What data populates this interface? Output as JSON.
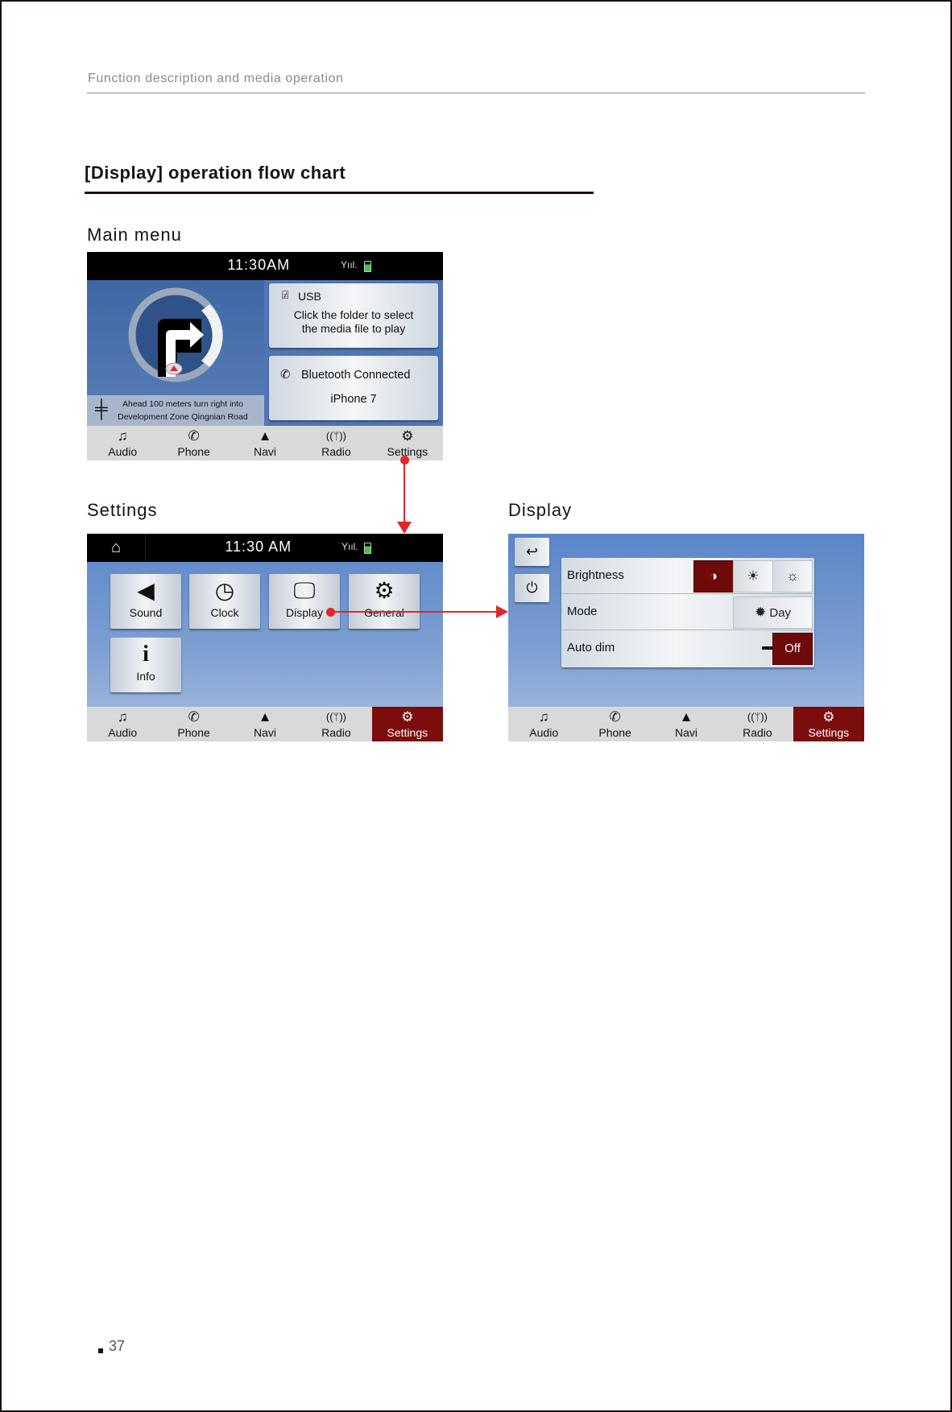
{
  "page": {
    "running_head": "Function description and media operation",
    "section_title": "[Display] operation flow chart",
    "page_number": "37"
  },
  "colors": {
    "accent_red": "#e2262b",
    "active_tab": "#7c0d0d",
    "screen_blue": "#5a86c8"
  },
  "screens": {
    "main_menu": {
      "label": "Main menu",
      "status": {
        "time": "11:30AM",
        "signal_icon": "signal-icon",
        "battery_icon": "battery-icon"
      },
      "nav_guide": {
        "instruction_line1": "Ahead 100 meters turn right into",
        "instruction_line2": "Development Zone Qingnian Road",
        "turn_icon": "turn-right-icon",
        "sign_icon": "signpost-icon"
      },
      "usb_card": {
        "title": "USB",
        "line1": "Click the folder to select",
        "line2": "the media file to play"
      },
      "bt_card": {
        "title": "Bluetooth Connected",
        "device": "iPhone 7"
      }
    },
    "settings": {
      "label": "Settings",
      "status": {
        "time": "11:30 AM"
      },
      "tiles": [
        {
          "label": "Sound",
          "icon": "speaker-icon"
        },
        {
          "label": "Clock",
          "icon": "clock-icon"
        },
        {
          "label": "Display",
          "icon": "monitor-icon"
        },
        {
          "label": "General",
          "icon": "gears-icon"
        },
        {
          "label": "Info",
          "icon": "info-icon"
        }
      ]
    },
    "display": {
      "label": "Display",
      "rows": {
        "brightness": {
          "label": "Brightness",
          "options": [
            "low",
            "medium",
            "high"
          ],
          "selected": "low"
        },
        "mode": {
          "label": "Mode",
          "value": "Day"
        },
        "auto_dim": {
          "label": "Auto dim",
          "value": "Off"
        }
      }
    }
  },
  "navbar": {
    "items": [
      {
        "label": "Audio",
        "icon": "music-note-icon"
      },
      {
        "label": "Phone",
        "icon": "phone-icon"
      },
      {
        "label": "Navi",
        "icon": "navigation-arrow-icon"
      },
      {
        "label": "Radio",
        "icon": "radio-antenna-icon"
      },
      {
        "label": "Settings",
        "icon": "gears-icon"
      }
    ]
  }
}
